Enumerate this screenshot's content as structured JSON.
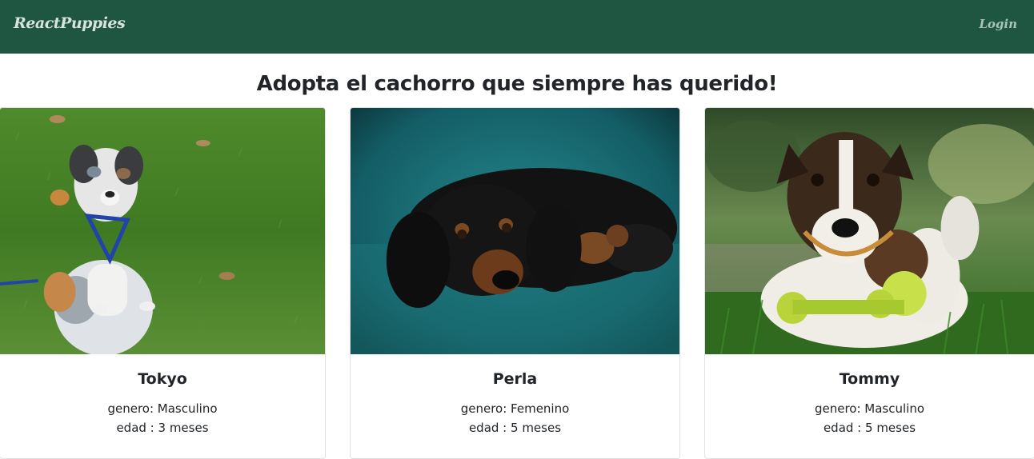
{
  "navbar": {
    "brand": "ReactPuppies",
    "login": "Login",
    "background": "#1f5641"
  },
  "page": {
    "title": "Adopta el cachorro que siempre has querido!"
  },
  "puppies": [
    {
      "name": "Tokyo",
      "gender": "genero: Masculino",
      "age": "edad : 3 meses",
      "photo_icon": "puppy-on-grass-photo"
    },
    {
      "name": "Perla",
      "gender": "genero: Femenino",
      "age": "edad : 5 meses",
      "photo_icon": "dachshund-on-teal-couch-photo"
    },
    {
      "name": "Tommy",
      "gender": "genero: Masculino",
      "age": "edad : 5 meses",
      "photo_icon": "terrier-with-toy-photo"
    }
  ]
}
